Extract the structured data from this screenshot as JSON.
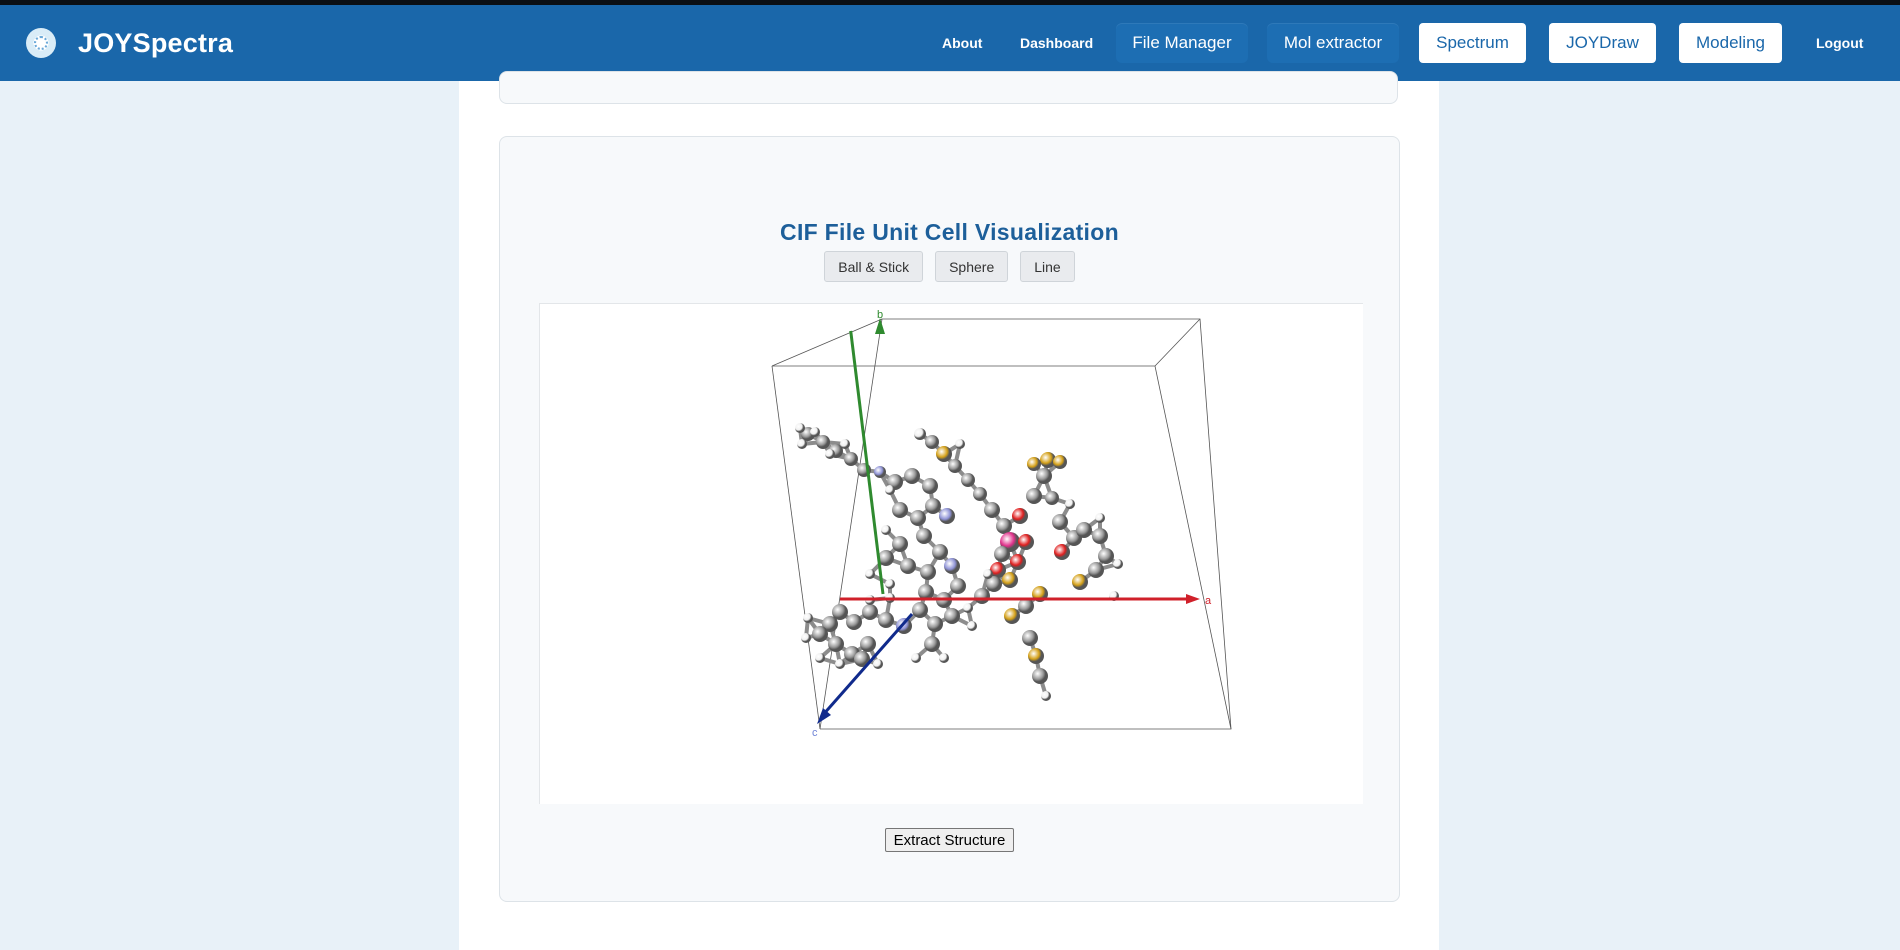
{
  "app": {
    "title": "JOYSpectra",
    "logo_icon": "spectra-logo-icon"
  },
  "nav": {
    "about": "About",
    "dashboard": "Dashboard",
    "file_manager": "File Manager",
    "mol_extractor": "Mol extractor",
    "spectrum": "Spectrum",
    "joydraw": "JOYDraw",
    "modeling": "Modeling",
    "logout": "Logout"
  },
  "colors": {
    "navbar": "#1a67aa",
    "page_background": "#e8f1f8",
    "title": "#1d5f9a",
    "axis_a": "#d0202a",
    "axis_b": "#2f8a2f",
    "axis_c": "#102a8c",
    "carbon": "#9a9a9a",
    "hydrogen": "#f0f0f0",
    "nitrogen": "#8f93d6",
    "oxygen": "#e01e1e",
    "sulfur": "#d4a017",
    "metal": "#e0308a"
  },
  "cif": {
    "title": "CIF File Unit Cell Visualization",
    "styles": [
      "Ball & Stick",
      "Sphere",
      "Line"
    ],
    "axis_labels": {
      "a": "a",
      "b": "b",
      "c": "c"
    },
    "extract_label": "Extract Structure"
  }
}
